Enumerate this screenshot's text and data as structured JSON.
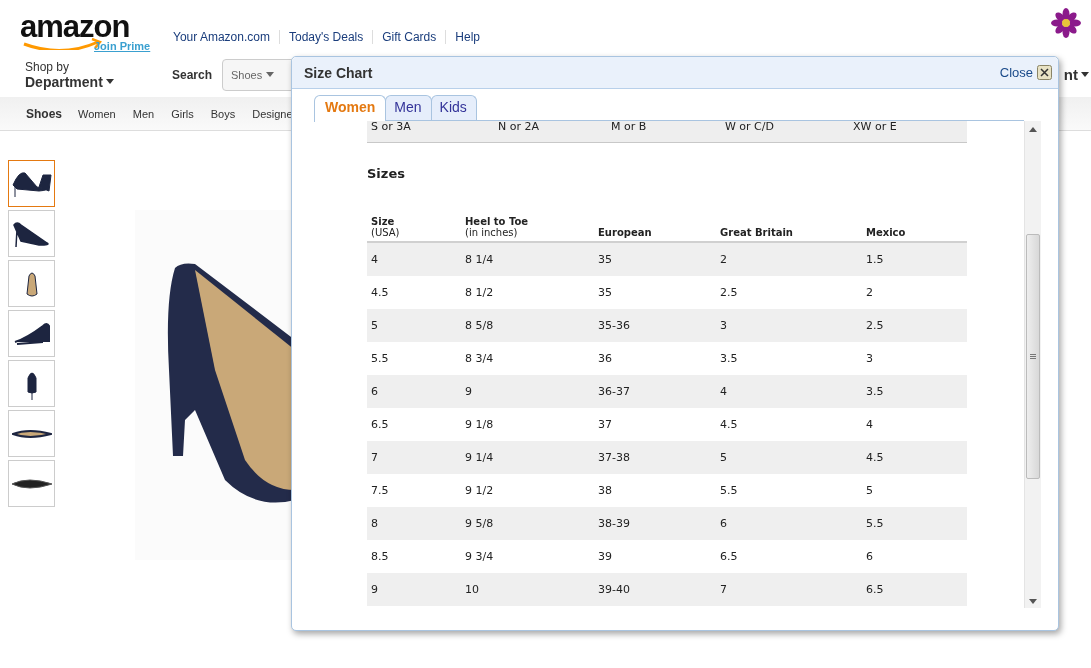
{
  "header": {
    "logo": "amazon",
    "prime_link": "Join Prime",
    "top_links": [
      "Your Amazon.com",
      "Today's Deals",
      "Gift Cards",
      "Help"
    ]
  },
  "search_bar": {
    "shop_by": "Shop by",
    "department": "Department",
    "search_label": "Search",
    "category": "Shoes",
    "account_fragment": "nt"
  },
  "category_nav": {
    "store": "Shoes",
    "links": [
      "Women",
      "Men",
      "Girls",
      "Boys",
      "Designe"
    ]
  },
  "thumbnails": [
    {
      "selected": true
    },
    {
      "selected": false
    },
    {
      "selected": false
    },
    {
      "selected": false
    },
    {
      "selected": false
    },
    {
      "selected": false
    },
    {
      "selected": false
    }
  ],
  "dialog": {
    "title": "Size Chart",
    "close": "Close",
    "tabs": [
      {
        "label": "Women",
        "selected": true
      },
      {
        "label": "Men",
        "selected": false
      },
      {
        "label": "Kids",
        "selected": false
      }
    ],
    "widths_row": [
      "S or 3A",
      "N or 2A",
      "M or B",
      "W or C/D",
      "XW or E"
    ],
    "section_title": "Sizes",
    "table": {
      "columns": [
        {
          "label": "Size",
          "sub": "(USA)"
        },
        {
          "label": "Heel to Toe",
          "sub": "(in inches)"
        },
        {
          "label": "European"
        },
        {
          "label": "Great Britain"
        },
        {
          "label": "Mexico"
        }
      ],
      "rows": [
        [
          "4",
          "8 1/4",
          "35",
          "2",
          "1.5"
        ],
        [
          "4.5",
          "8 1/2",
          "35",
          "2.5",
          "2"
        ],
        [
          "5",
          "8 5/8",
          "35-36",
          "3",
          "2.5"
        ],
        [
          "5.5",
          "8 3/4",
          "36",
          "3.5",
          "3"
        ],
        [
          "6",
          "9",
          "36-37",
          "4",
          "3.5"
        ],
        [
          "6.5",
          "9 1/8",
          "37",
          "4.5",
          "4"
        ],
        [
          "7",
          "9 1/4",
          "37-38",
          "5",
          "4.5"
        ],
        [
          "7.5",
          "9 1/2",
          "38",
          "5.5",
          "5"
        ],
        [
          "8",
          "9 5/8",
          "38-39",
          "6",
          "5.5"
        ],
        [
          "8.5",
          "9 3/4",
          "39",
          "6.5",
          "6"
        ],
        [
          "9",
          "10",
          "39-40",
          "7",
          "6.5"
        ]
      ]
    }
  }
}
